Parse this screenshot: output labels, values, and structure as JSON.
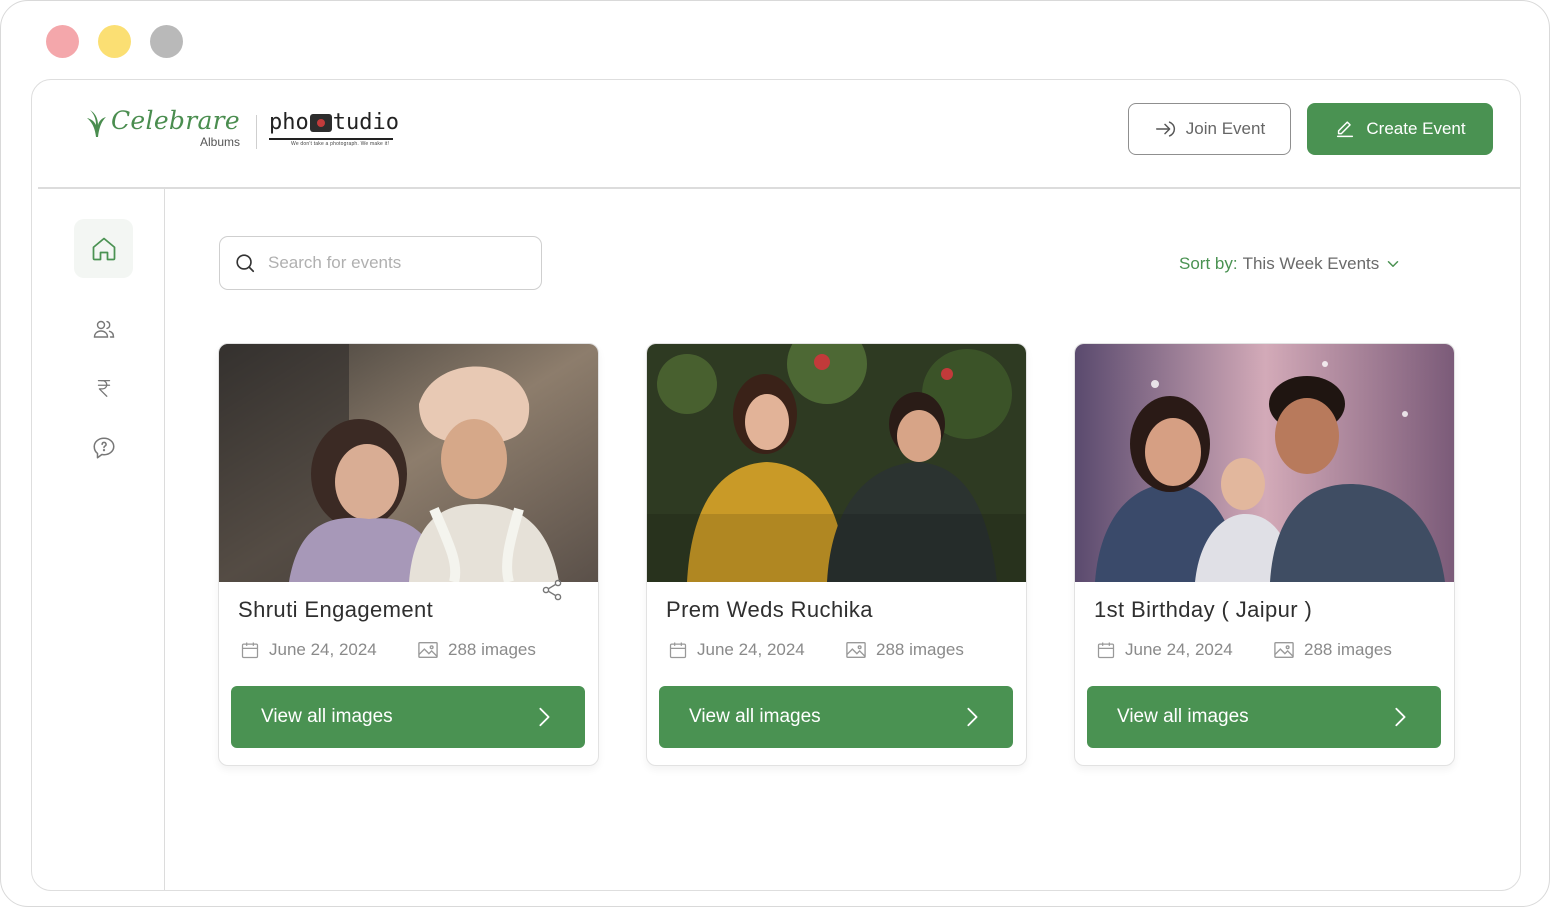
{
  "window": {
    "traffic_lights": [
      "close",
      "minimize",
      "maximize"
    ]
  },
  "header": {
    "brand": {
      "name": "Celebrare",
      "sub": "Albums"
    },
    "partner": {
      "name_left": "pho",
      "name_right": "tudio",
      "tagline": "We don't take a photograph. We make it!"
    },
    "join_label": "Join Event",
    "create_label": "Create Event"
  },
  "sidebar": {
    "items": [
      {
        "name": "home",
        "icon": "home-icon",
        "active": true
      },
      {
        "name": "users",
        "icon": "users-icon",
        "active": false
      },
      {
        "name": "payments",
        "icon": "rupee-icon",
        "active": false
      },
      {
        "name": "help",
        "icon": "help-chat-icon",
        "active": false
      }
    ]
  },
  "search": {
    "placeholder": "Search for events",
    "value": ""
  },
  "sort": {
    "label": "Sort by:",
    "value": "This Week Events"
  },
  "events": [
    {
      "title": "Shruti Engagement",
      "date": "June 24, 2024",
      "images": "288 images",
      "button": "View all images"
    },
    {
      "title": "Prem Weds Ruchika",
      "date": "June 24, 2024",
      "images": "288 images",
      "button": "View all images"
    },
    {
      "title": "1st Birthday ( Jaipur )",
      "date": "June 24, 2024",
      "images": "288 images",
      "button": "View all images"
    }
  ],
  "colors": {
    "accent": "#4a9252",
    "border": "#dcdcdc",
    "muted_text": "#8a8a8a"
  }
}
